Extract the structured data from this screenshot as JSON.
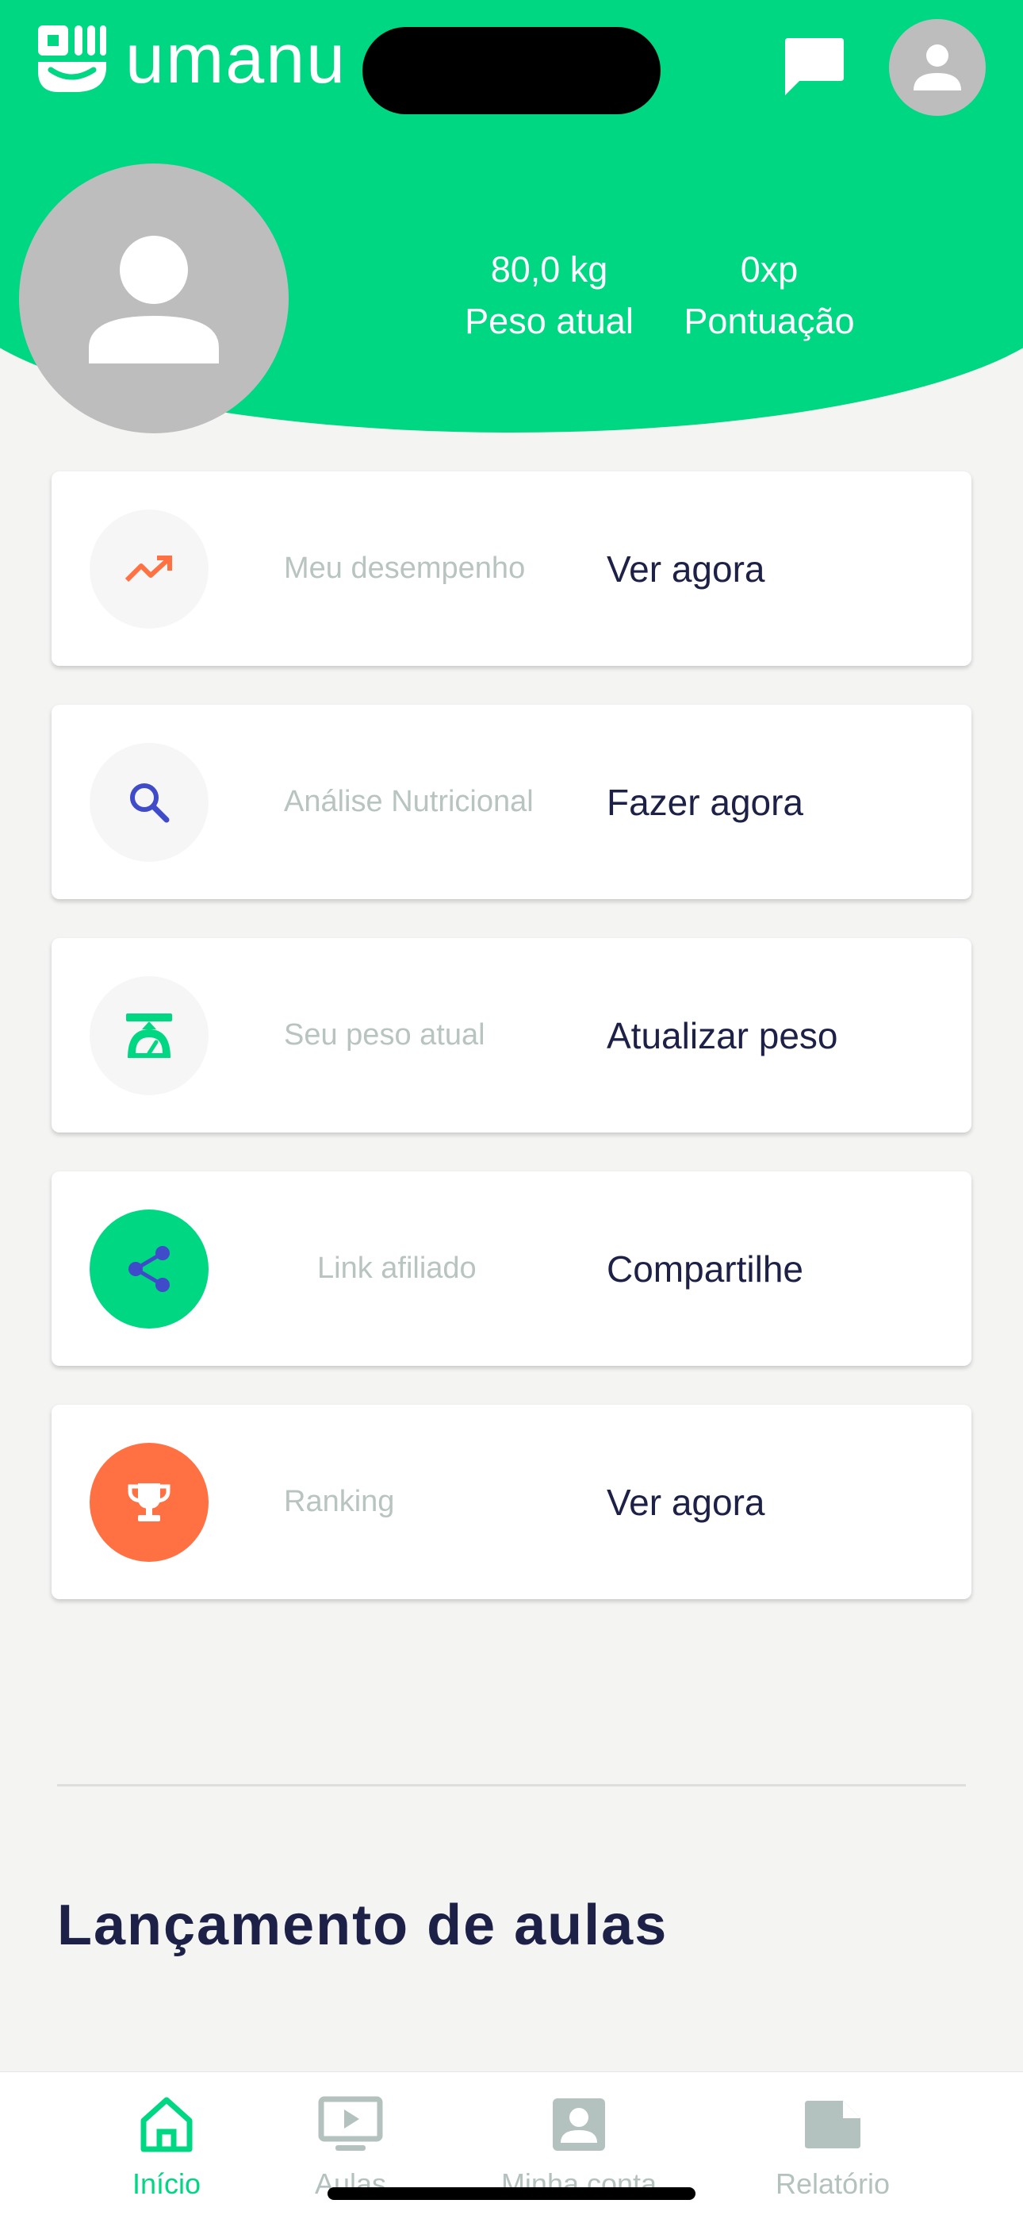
{
  "header": {
    "app_name": "umanu",
    "chat_icon": "chat-icon",
    "account_icon": "person-icon",
    "stats": {
      "weight_value": "80,0 kg",
      "weight_label": "Peso atual",
      "points_value": "0xp",
      "points_label": "Pontuação"
    }
  },
  "cards": [
    {
      "icon": "trending-up-icon",
      "label": "Meu desempenho",
      "action": "Ver agora",
      "icon_bg": "#f6f6f6",
      "icon_color": "#ff7043"
    },
    {
      "icon": "search-icon",
      "label": "Análise Nutricional",
      "action": "Fazer agora",
      "icon_bg": "#f6f6f6",
      "icon_color": "#3f4bc8"
    },
    {
      "icon": "scale-icon",
      "label": "Seu peso atual",
      "action": "Atualizar peso",
      "icon_bg": "#f6f6f6",
      "icon_color": "#00d782"
    },
    {
      "icon": "share-icon",
      "label": "Link afiliado",
      "action": "Compartilhe",
      "icon_bg": "#00d782",
      "icon_color": "#3f4bc8"
    },
    {
      "icon": "trophy-icon",
      "label": "Ranking",
      "action": "Ver agora",
      "icon_bg": "#ff7043",
      "icon_color": "#ffffff"
    }
  ],
  "section": {
    "title": "Lançamento de aulas"
  },
  "nav": [
    {
      "icon": "home-icon",
      "label": "Início",
      "active": true
    },
    {
      "icon": "play-tv-icon",
      "label": "Aulas",
      "active": false
    },
    {
      "icon": "account-box-icon",
      "label": "Minha conta",
      "active": false
    },
    {
      "icon": "document-icon",
      "label": "Relatório",
      "active": false
    }
  ],
  "colors": {
    "brand": "#00d782",
    "accent_orange": "#ff7043",
    "navy": "#1e2147",
    "muted_text": "#b8c4bf"
  }
}
